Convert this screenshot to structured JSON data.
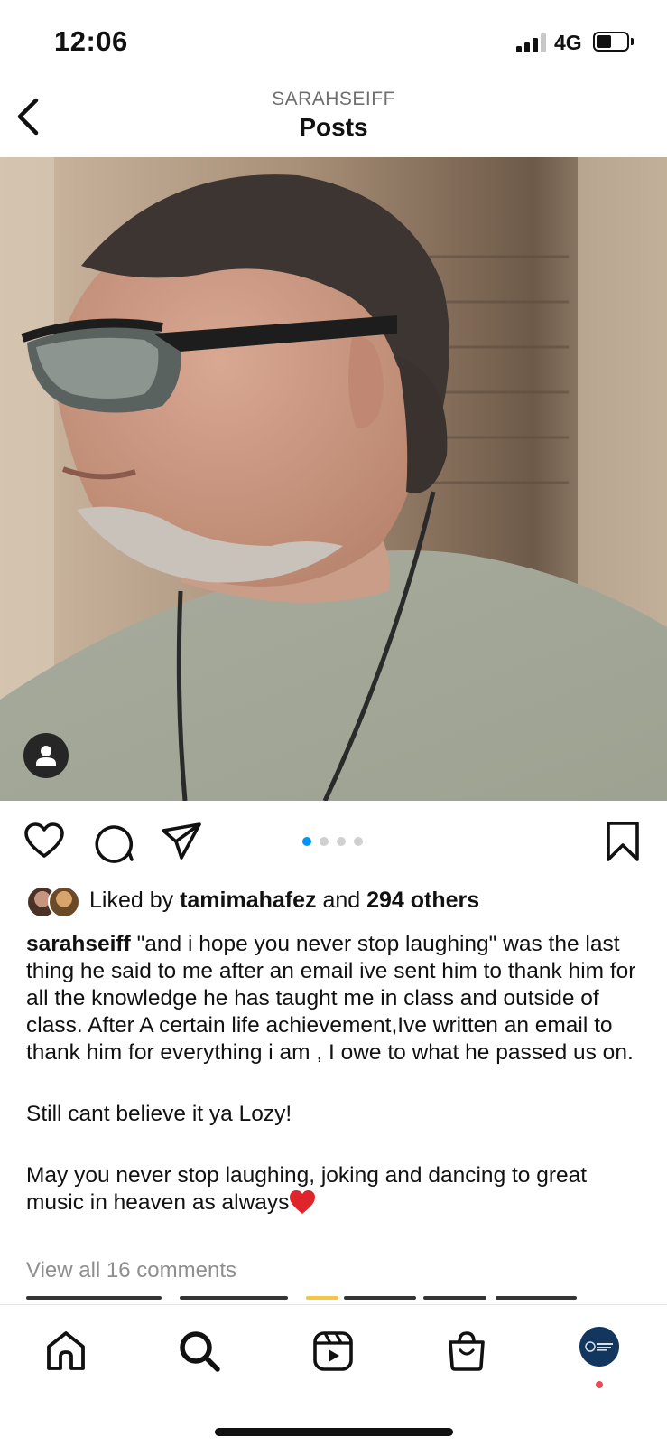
{
  "status_bar": {
    "time": "12:06",
    "network": "4G"
  },
  "header": {
    "subtitle": "SARAHSEIFF",
    "title": "Posts"
  },
  "post": {
    "carousel": {
      "count": 4,
      "active_index": 0
    },
    "likes": {
      "prefix": "Liked by ",
      "first_liker": "tamimahafez",
      "middle": " and ",
      "others": "294 others"
    },
    "caption": {
      "username": "sarahseiff",
      "text1": " \"and i hope you never stop laughing\" was the last thing he said to me after an email ive sent him to thank him for all the knowledge he has taught me in class and outside of class. After A certain life achievement,Ive written an email to thank him for everything i am , I owe to what he passed us on.",
      "text2": "Still cant believe it ya Lozy!",
      "text3": "May you never stop laughing, joking and dancing to great music in heaven as always"
    },
    "view_comments": "View all 16 comments"
  },
  "icons": {
    "back": "chevron-left-icon",
    "tag": "person-tag-icon",
    "like": "heart-icon",
    "comment": "comment-bubble-icon",
    "share": "paper-plane-icon",
    "save": "bookmark-icon",
    "home": "home-icon",
    "search": "search-icon",
    "reels": "reels-icon",
    "shop": "shopping-bag-icon",
    "profile": "profile-avatar"
  },
  "colors": {
    "accent": "#0095f6",
    "notification": "#ed4956",
    "heart_emoji": "#e0242b"
  }
}
